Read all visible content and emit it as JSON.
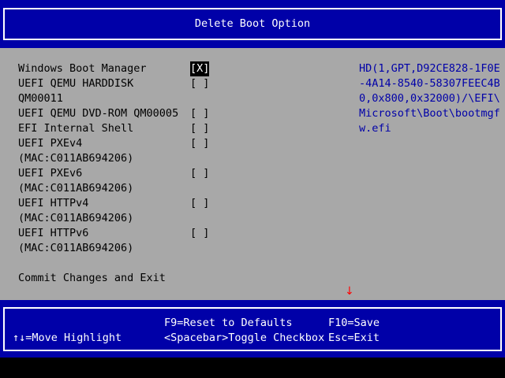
{
  "title": "Delete Boot Option",
  "options": [
    {
      "label": "Windows Boot Manager",
      "checkbox": "[X]",
      "selected": true
    },
    {
      "label": "UEFI QEMU HARDDISK",
      "checkbox": "[ ]"
    },
    {
      "label": "QM00011",
      "checkbox": ""
    },
    {
      "label": "UEFI QEMU DVD-ROM QM00005",
      "checkbox": "[ ]"
    },
    {
      "label": "EFI Internal Shell",
      "checkbox": "[ ]"
    },
    {
      "label": "UEFI PXEv4",
      "checkbox": "[ ]"
    },
    {
      "label": "(MAC:C011AB694206)",
      "checkbox": ""
    },
    {
      "label": "UEFI PXEv6",
      "checkbox": "[ ]"
    },
    {
      "label": "(MAC:C011AB694206)",
      "checkbox": ""
    },
    {
      "label": "UEFI HTTPv4",
      "checkbox": "[ ]"
    },
    {
      "label": "(MAC:C011AB694206)",
      "checkbox": ""
    },
    {
      "label": "UEFI HTTPv6",
      "checkbox": "[ ]"
    },
    {
      "label": "(MAC:C011AB694206)",
      "checkbox": ""
    }
  ],
  "commit_label": "Commit Changes and Exit",
  "help_lines": [
    "HD(1,GPT,D92CE828-1F0E",
    "-4A14-8540-58307FEEC4B",
    "0,0x800,0x32000)/\\EFI\\",
    "Microsoft\\Boot\\bootmgf",
    "w.efi"
  ],
  "scroll_indicator": "↓",
  "keys": {
    "move": "↑↓=Move Highlight",
    "f9": "F9=Reset to Defaults",
    "spacebar": "<Spacebar>Toggle Checkbox",
    "f10": "F10=Save",
    "esc": "Esc=Exit"
  },
  "colors": {
    "bios_blue": "#0000a8",
    "body_gray": "#a8a8a8",
    "help_text_blue": "#0000a8",
    "scroll_arrow_red": "#ff0000",
    "text_white": "#ffffff"
  }
}
